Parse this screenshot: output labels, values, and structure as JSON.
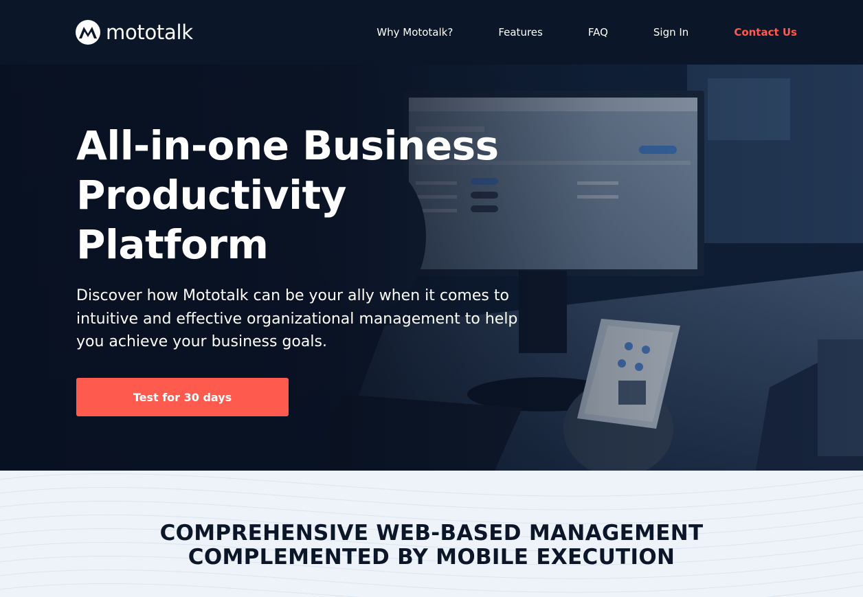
{
  "brand": {
    "name": "mototalk",
    "logo_icon": "motorola-batwing-icon"
  },
  "nav": {
    "items": [
      {
        "label": "Why Mototalk?"
      },
      {
        "label": "Features"
      },
      {
        "label": "FAQ"
      },
      {
        "label": "Sign In"
      },
      {
        "label": "Contact Us"
      }
    ]
  },
  "hero": {
    "title": "All-in-one Business Productivity Platform",
    "subtitle": "Discover how Mototalk can be your ally when it comes to intuitive and effective organizational management to help you achieve your business goals.",
    "cta_label": "Test for 30 days"
  },
  "section": {
    "title_line1": "COMPREHENSIVE WEB-BASED MANAGEMENT",
    "title_line2": "COMPLEMENTED BY MOBILE EXECUTION"
  },
  "colors": {
    "nav_bg": "#0b1628",
    "accent": "#ff5a4e",
    "section_bg": "#eef3f9",
    "heading_dark": "#0b1628"
  }
}
